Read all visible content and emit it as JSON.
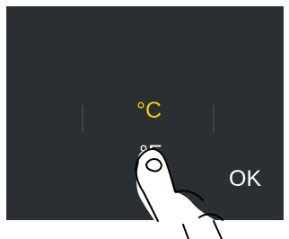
{
  "screen": {
    "background_color": "#2a2f33",
    "options": [
      {
        "label": "°C",
        "selected": true,
        "color": "#f5d000"
      },
      {
        "label": "°F",
        "selected": false,
        "color": "#ffffff"
      }
    ],
    "ok_label": "OK",
    "ok_color": "#ffffff"
  },
  "overlay": {
    "icon": "pointing-finger-icon"
  }
}
